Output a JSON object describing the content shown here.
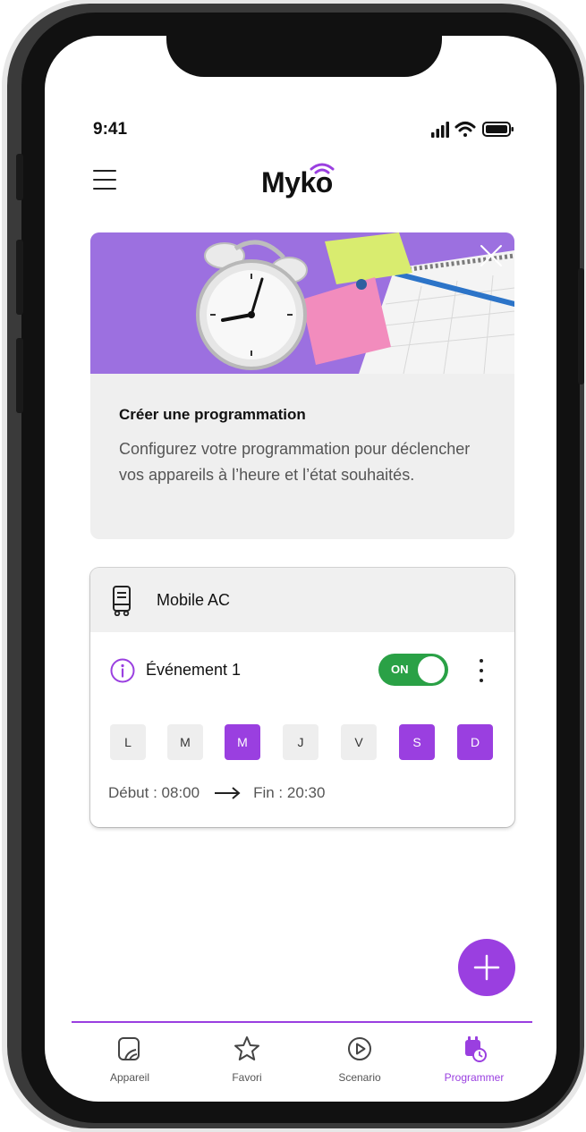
{
  "status_bar": {
    "time": "9:41"
  },
  "header": {
    "logo": "Myko"
  },
  "promo": {
    "title": "Créer une programmation",
    "description": "Configurez votre programmation pour déclencher vos appareils à l’heure et l’état souhaités."
  },
  "device": {
    "name": "Mobile AC",
    "event": {
      "name": "Événement 1",
      "toggle_label": "ON",
      "enabled": true,
      "days": [
        {
          "label": "L",
          "active": false
        },
        {
          "label": "M",
          "active": false
        },
        {
          "label": "M",
          "active": true
        },
        {
          "label": "J",
          "active": false
        },
        {
          "label": "V",
          "active": false
        },
        {
          "label": "S",
          "active": true
        },
        {
          "label": "D",
          "active": true
        }
      ],
      "start": "Début : 08:00",
      "end": "Fin : 20:30"
    }
  },
  "bottom_nav": {
    "items": [
      {
        "label": "Appareil",
        "icon": "device-icon",
        "active": false
      },
      {
        "label": "Favori",
        "icon": "star-icon",
        "active": false
      },
      {
        "label": "Scenario",
        "icon": "play-icon",
        "active": false
      },
      {
        "label": "Programmer",
        "icon": "calendar-clock-icon",
        "active": true
      }
    ]
  },
  "colors": {
    "accent": "#9a3fe0",
    "toggle_on": "#2aa146",
    "card_bg": "#efefef"
  }
}
